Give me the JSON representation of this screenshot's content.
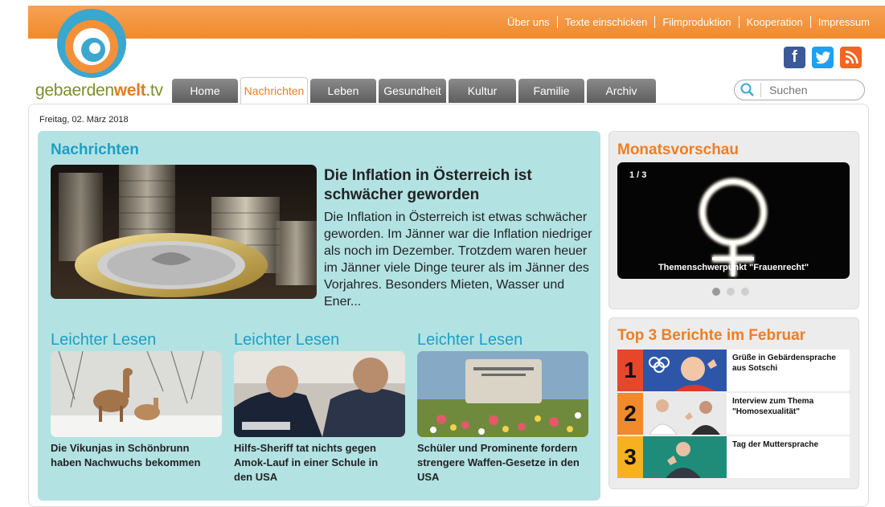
{
  "header": {
    "top_links": [
      "Über uns",
      "Texte einschicken",
      "Filmproduktion",
      "Kooperation",
      "Impressum"
    ],
    "logo": {
      "text_part1": "gebaerden",
      "text_part2": "welt",
      "text_part3": ".tv"
    },
    "social": [
      {
        "name": "facebook-icon",
        "glyph": "f",
        "color": "#3b5998"
      },
      {
        "name": "twitter-icon",
        "glyph": "t",
        "color": "#1da1f2"
      },
      {
        "name": "rss-icon",
        "glyph": "rss",
        "color": "#f26522"
      }
    ]
  },
  "nav": {
    "tabs": [
      "Home",
      "Nachrichten",
      "Leben",
      "Gesundheit",
      "Kultur",
      "Familie",
      "Archiv"
    ],
    "active": "Nachrichten"
  },
  "search": {
    "placeholder": "Suchen"
  },
  "date": "Freitag, 02. März 2018",
  "news": {
    "heading": "Nachrichten",
    "main": {
      "title": "Die Inflation in Österreich ist schwächer geworden",
      "text": "Die Inflation in Österreich ist etwas schwächer geworden. Im Jänner war die Inflation niedriger als noch im Dezember. Trotzdem waren heuer im Jänner viele Dinge teurer als im Jänner des Vorjahres. Besonders Mieten, Wasser und Ener..."
    },
    "leichter": [
      {
        "heading": "Leichter Lesen",
        "caption": "Die Vikunjas in Schönbrunn haben Nachwuchs bekommen"
      },
      {
        "heading": "Leichter Lesen",
        "caption": "Hilfs-Sheriff tat nichts gegen Amok-Lauf in einer Schule in den USA"
      },
      {
        "heading": "Leichter Lesen",
        "caption": "Schüler und Prominente fordern strengere Waffen-Gesetze in den USA"
      }
    ]
  },
  "monats": {
    "heading": "Monatsvorschau",
    "counter": "1 / 3",
    "caption": "Themenschwerpunkt \"Frauenrecht\""
  },
  "top3": {
    "heading": "Top 3 Berichte im Februar",
    "items": [
      {
        "num": "1",
        "title": "Grüße in Gebärdensprache aus Sotschi",
        "color": "#e8452d"
      },
      {
        "num": "2",
        "title": "Interview zum Thema \"Homosexualität\"",
        "color": "#f08a2c"
      },
      {
        "num": "3",
        "title": "Tag der Muttersprache",
        "color": "#f6b21e"
      }
    ]
  },
  "colors": {
    "accent": "#ee7e24",
    "teal": "#1f9ec4",
    "news_bg": "#b3e2e3"
  }
}
